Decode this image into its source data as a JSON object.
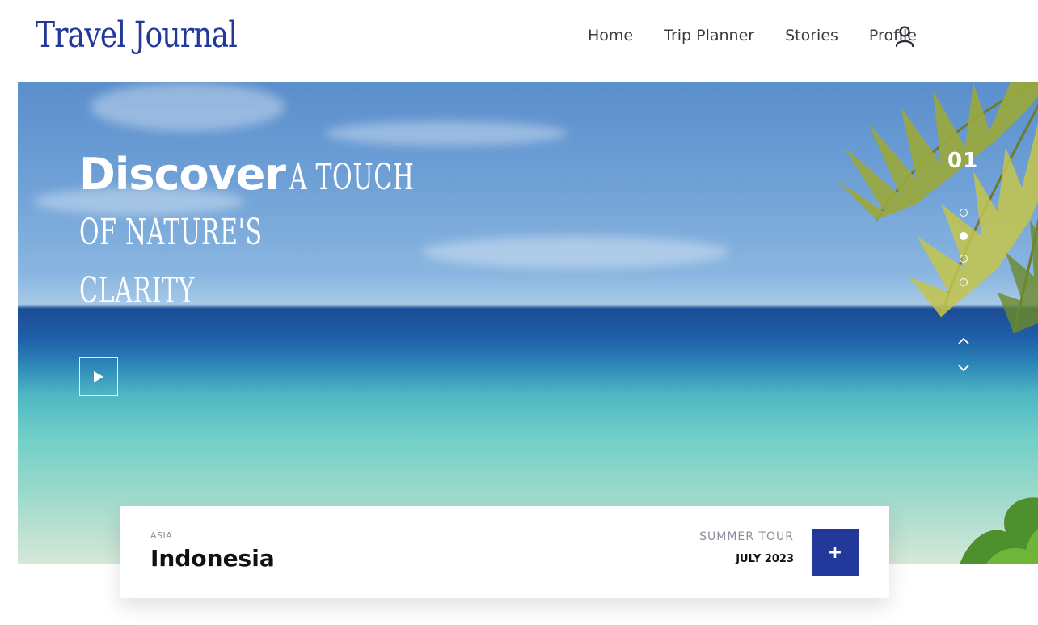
{
  "header": {
    "logo": "Travel Journal",
    "nav": [
      "Home",
      "Trip Planner",
      "Stories",
      "Profile"
    ],
    "user_icon": "user-icon"
  },
  "hero": {
    "title_strong": "Discover",
    "title_line1": "A TOUCH",
    "title_line2": "OF NATURE'S",
    "title_line3": "CLARITY",
    "play_icon": "play-icon",
    "slide_number": "01",
    "slides_total": 4,
    "active_slide_index": 1,
    "arrow_up_icon": "chevron-up-icon",
    "arrow_down_icon": "chevron-down-icon"
  },
  "card": {
    "region": "ASIA",
    "country": "Indonesia",
    "tour": "SUMMER TOUR",
    "date": "JULY 2023",
    "add_label": "+"
  },
  "colors": {
    "brand": "#22389a",
    "nav_text": "#3a3a44",
    "muted": "#8b8f9a"
  }
}
